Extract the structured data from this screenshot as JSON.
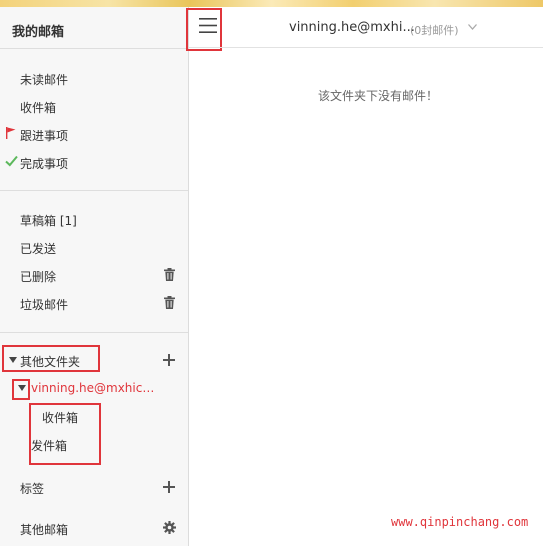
{
  "sidebar": {
    "title": "我的邮箱",
    "quick_items": [
      {
        "label": "未读邮件"
      },
      {
        "label": "收件箱"
      },
      {
        "label": "跟进事项"
      },
      {
        "label": "完成事项"
      }
    ],
    "folders": [
      {
        "label": "草稿箱 [1]"
      },
      {
        "label": "已发送"
      },
      {
        "label": "已删除"
      },
      {
        "label": "垃圾邮件"
      }
    ],
    "other_folders": {
      "label": "其他文件夹",
      "account": "vinning.he@mxhichin...",
      "subfolders": [
        {
          "label": "收件箱"
        },
        {
          "label": "发件箱"
        }
      ]
    },
    "tags_label": "标签",
    "other_mailboxes_label": "其他邮箱"
  },
  "header": {
    "account": "vinning.he@mxhi...",
    "mail_count": "(0封邮件)"
  },
  "main": {
    "empty_message": "该文件夹下没有邮件！"
  },
  "watermark": "www.qinpinchang.com",
  "colors": {
    "highlight_box": "#e0353b",
    "flag": "#e0353b",
    "check": "#5cb85c"
  }
}
